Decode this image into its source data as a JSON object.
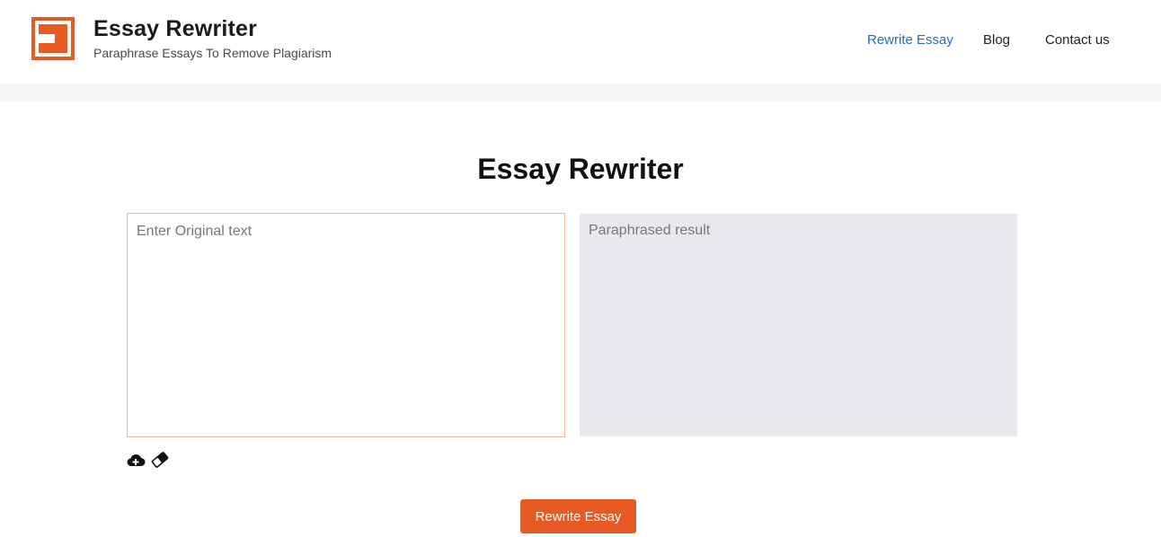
{
  "header": {
    "brand_title": "Essay Rewriter",
    "brand_tagline": "Paraphrase Essays To Remove Plagiarism",
    "logo_icon": "essay-rewriter-logo",
    "nav": {
      "rewrite_essay": "Rewrite Essay",
      "blog": "Blog",
      "contact_us": "Contact us"
    }
  },
  "main": {
    "title": "Essay Rewriter",
    "input": {
      "value": "",
      "placeholder": "Enter Original text"
    },
    "result": {
      "placeholder": "Paraphrased result"
    },
    "tools": {
      "upload_icon": "cloud-upload-icon",
      "eraser_icon": "eraser-icon"
    },
    "rewrite_button": "Rewrite Essay"
  },
  "colors": {
    "accent": "#e85a24",
    "nav_active": "#2b6cb0",
    "result_bg": "#e8e9ee",
    "input_border": "#ecb9a0"
  }
}
